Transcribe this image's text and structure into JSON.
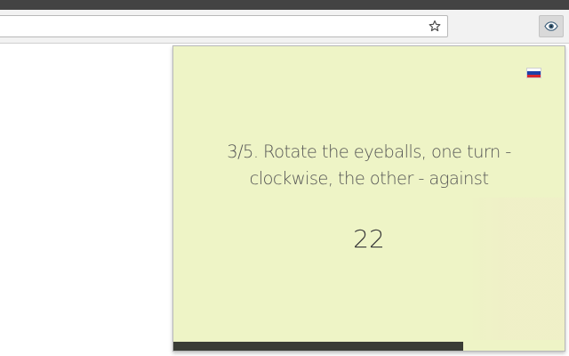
{
  "browser": {
    "bookmark_icon": "star-outline-icon",
    "extension_icon": "eye-icon"
  },
  "popup": {
    "language_flag": "russian-flag-icon",
    "instruction": "3/5. Rotate the eyeballs, one turn - clockwise, the other - against",
    "counter": "22",
    "progress": 0.74,
    "progress_color": "#3b3d36",
    "background_color": "#eef4c6"
  }
}
